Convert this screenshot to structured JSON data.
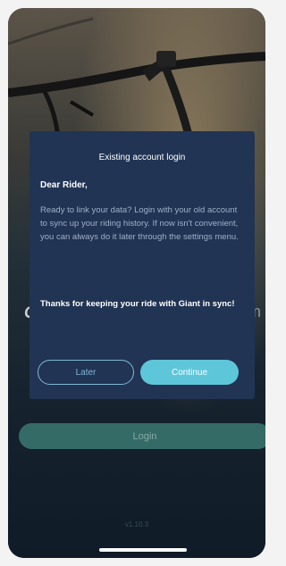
{
  "dialog": {
    "title": "Existing account login",
    "greeting": "Dear Rider,",
    "body": "Ready to link your data? Login with your old account to sync up your riding history. If now isn't convenient, you can always do it later through the settings menu.",
    "thanks": "Thanks for keeping your ride with Giant in sync!",
    "later_label": "Later",
    "continue_label": "Continue"
  },
  "background": {
    "logo_left": "G",
    "logo_right": "m",
    "login_label": "Login",
    "version": "v1.10.3"
  },
  "colors": {
    "dialog_bg": "#213454",
    "accent": "#5ec6d9",
    "login_button": "#356b66"
  },
  "icons": [
    "bicycle-handlebar-image",
    "home-indicator"
  ]
}
